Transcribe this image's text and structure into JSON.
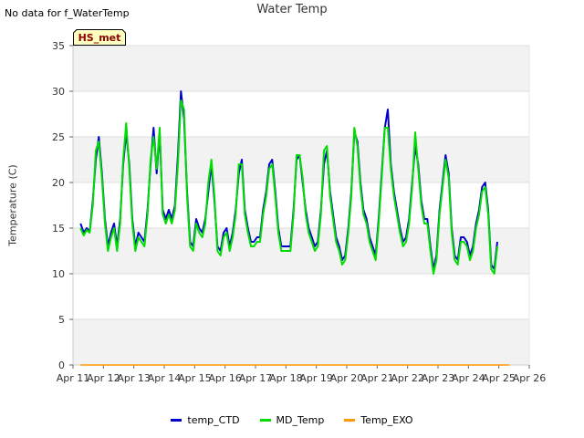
{
  "header": {
    "no_data_text": "No data for f_WaterTemp",
    "badge_label": "HS_met"
  },
  "chart_data": {
    "type": "line",
    "title": "Water Temp",
    "xlabel": "",
    "ylabel": "Temperature (C)",
    "ylim": [
      0,
      35
    ],
    "yticks": [
      0,
      5,
      10,
      15,
      20,
      25,
      30,
      35
    ],
    "xlim": [
      0,
      15
    ],
    "xticks": [
      0,
      1,
      2,
      3,
      4,
      5,
      6,
      7,
      8,
      9,
      10,
      11,
      12,
      13,
      14,
      15
    ],
    "xtick_labels": [
      "Apr 11",
      "Apr 12",
      "Apr 13",
      "Apr 14",
      "Apr 15",
      "Apr 16",
      "Apr 17",
      "Apr 18",
      "Apr 19",
      "Apr 20",
      "Apr 21",
      "Apr 22",
      "Apr 23",
      "Apr 24",
      "Apr 25",
      "Apr 26"
    ],
    "grid": true,
    "legend_position": "bottom",
    "x": [
      0.25,
      0.35,
      0.45,
      0.55,
      0.65,
      0.75,
      0.85,
      0.95,
      1.05,
      1.15,
      1.25,
      1.35,
      1.45,
      1.55,
      1.65,
      1.75,
      1.85,
      1.95,
      2.05,
      2.15,
      2.25,
      2.35,
      2.45,
      2.55,
      2.65,
      2.75,
      2.85,
      2.95,
      3.05,
      3.15,
      3.25,
      3.35,
      3.45,
      3.55,
      3.65,
      3.75,
      3.85,
      3.95,
      4.05,
      4.15,
      4.25,
      4.35,
      4.45,
      4.55,
      4.65,
      4.75,
      4.85,
      4.95,
      5.05,
      5.15,
      5.25,
      5.35,
      5.45,
      5.55,
      5.65,
      5.75,
      5.85,
      5.95,
      6.05,
      6.15,
      6.25,
      6.35,
      6.45,
      6.55,
      6.65,
      6.75,
      6.85,
      6.95,
      7.05,
      7.15,
      7.25,
      7.35,
      7.45,
      7.55,
      7.65,
      7.75,
      7.85,
      7.95,
      8.05,
      8.15,
      8.25,
      8.35,
      8.45,
      8.55,
      8.65,
      8.75,
      8.85,
      8.95,
      9.05,
      9.15,
      9.25,
      9.35,
      9.45,
      9.55,
      9.65,
      9.75,
      9.85,
      9.95,
      10.05,
      10.15,
      10.25,
      10.35,
      10.45,
      10.55,
      10.65,
      10.75,
      10.85,
      10.95,
      11.05,
      11.15,
      11.25,
      11.35,
      11.45,
      11.55,
      11.65,
      11.75,
      11.85,
      11.95,
      12.05,
      12.15,
      12.25,
      12.35,
      12.45,
      12.55,
      12.65,
      12.75,
      12.85,
      12.95,
      13.05,
      13.15,
      13.25,
      13.35,
      13.45,
      13.55,
      13.65,
      13.75,
      13.85,
      13.95,
      14.05,
      14.15,
      14.25,
      14.35
    ],
    "series": [
      {
        "name": "temp_CTD",
        "color": "#0000cc",
        "values": [
          15.5,
          14.5,
          15.0,
          14.6,
          18.0,
          22.5,
          25.0,
          21.0,
          16.0,
          13.0,
          14.5,
          15.5,
          13.0,
          16.0,
          22.0,
          25.5,
          22.0,
          16.0,
          13.0,
          14.5,
          14.0,
          13.5,
          17.0,
          22.0,
          26.0,
          21.0,
          25.5,
          17.0,
          16.0,
          17.0,
          16.0,
          17.5,
          23.0,
          30.0,
          27.0,
          19.0,
          13.5,
          13.0,
          16.0,
          15.0,
          14.5,
          16.0,
          19.0,
          22.0,
          18.0,
          13.0,
          12.5,
          14.5,
          15.0,
          13.0,
          14.5,
          17.0,
          21.0,
          22.5,
          17.0,
          15.0,
          13.5,
          13.5,
          14.0,
          14.0,
          17.0,
          19.0,
          22.0,
          22.5,
          19.0,
          15.0,
          13.0,
          13.0,
          13.0,
          13.0,
          17.0,
          22.5,
          23.0,
          20.0,
          17.0,
          15.0,
          14.0,
          13.0,
          13.5,
          17.0,
          22.0,
          23.5,
          19.0,
          16.5,
          14.0,
          13.0,
          11.5,
          12.0,
          15.0,
          19.0,
          25.5,
          24.5,
          20.0,
          17.0,
          16.0,
          14.0,
          13.0,
          12.0,
          16.0,
          21.0,
          26.0,
          28.0,
          22.0,
          19.0,
          17.0,
          15.0,
          13.5,
          14.0,
          16.0,
          20.0,
          24.0,
          22.0,
          18.0,
          16.0,
          16.0,
          13.0,
          10.5,
          12.0,
          17.0,
          20.0,
          23.0,
          21.0,
          15.0,
          12.0,
          11.5,
          14.0,
          14.0,
          13.5,
          12.0,
          13.0,
          15.5,
          17.0,
          19.5,
          20.0,
          17.0,
          11.0,
          10.5,
          13.5
        ]
      },
      {
        "name": "MD_Temp",
        "color": "#00dd00",
        "values": [
          15.0,
          14.2,
          14.8,
          14.5,
          17.5,
          23.5,
          24.5,
          20.5,
          15.5,
          12.5,
          14.0,
          15.0,
          12.5,
          15.5,
          22.5,
          26.5,
          21.5,
          15.5,
          12.5,
          14.0,
          13.5,
          13.0,
          16.5,
          22.5,
          25.0,
          21.5,
          26.0,
          16.5,
          15.5,
          16.5,
          15.5,
          17.0,
          22.0,
          29.0,
          28.0,
          18.5,
          13.0,
          12.5,
          15.5,
          14.5,
          14.0,
          15.5,
          20.0,
          22.5,
          18.5,
          12.5,
          12.0,
          14.0,
          14.5,
          12.5,
          14.0,
          16.5,
          22.0,
          22.0,
          16.5,
          14.5,
          13.0,
          13.0,
          13.5,
          13.5,
          16.5,
          18.5,
          21.5,
          22.0,
          18.5,
          14.5,
          12.5,
          12.5,
          12.5,
          12.5,
          16.5,
          23.0,
          23.0,
          20.5,
          16.5,
          14.5,
          13.5,
          12.5,
          13.0,
          16.5,
          23.5,
          24.0,
          18.5,
          16.0,
          13.5,
          12.5,
          11.0,
          11.5,
          14.5,
          18.5,
          26.0,
          24.0,
          19.5,
          16.5,
          15.5,
          13.5,
          12.5,
          11.5,
          15.5,
          20.5,
          26.0,
          26.0,
          21.5,
          18.5,
          16.5,
          14.5,
          13.0,
          13.5,
          15.5,
          19.5,
          25.5,
          21.5,
          17.5,
          15.5,
          15.5,
          12.5,
          10.0,
          11.5,
          16.5,
          19.5,
          22.5,
          20.5,
          14.5,
          11.5,
          11.0,
          13.5,
          13.5,
          13.0,
          11.5,
          12.5,
          15.0,
          16.5,
          19.0,
          19.5,
          16.5,
          10.5,
          10.0,
          13.0
        ]
      },
      {
        "name": "Temp_EXO",
        "color": "#ff9900",
        "values": [
          0,
          0,
          0,
          0,
          0,
          0,
          0,
          0,
          0,
          0,
          0,
          0,
          0,
          0,
          0,
          0,
          0,
          0,
          0,
          0,
          0,
          0,
          0,
          0,
          0,
          0,
          0,
          0,
          0,
          0,
          0,
          0,
          0,
          0,
          0,
          0,
          0,
          0,
          0,
          0,
          0,
          0,
          0,
          0,
          0,
          0,
          0,
          0,
          0,
          0,
          0,
          0,
          0,
          0,
          0,
          0,
          0,
          0,
          0,
          0,
          0,
          0,
          0,
          0,
          0,
          0,
          0,
          0,
          0,
          0,
          0,
          0,
          0,
          0,
          0,
          0,
          0,
          0,
          0,
          0,
          0,
          0,
          0,
          0,
          0,
          0,
          0,
          0,
          0,
          0,
          0,
          0,
          0,
          0,
          0,
          0,
          0,
          0,
          0,
          0,
          0,
          0,
          0,
          0,
          0,
          0,
          0,
          0,
          0,
          0,
          0,
          0,
          0,
          0,
          0,
          0,
          0,
          0,
          0,
          0,
          0,
          0,
          0,
          0,
          0,
          0,
          0,
          0,
          0,
          0,
          0,
          0,
          0,
          0,
          0,
          0,
          0,
          0,
          0,
          0,
          0,
          0
        ]
      }
    ]
  }
}
